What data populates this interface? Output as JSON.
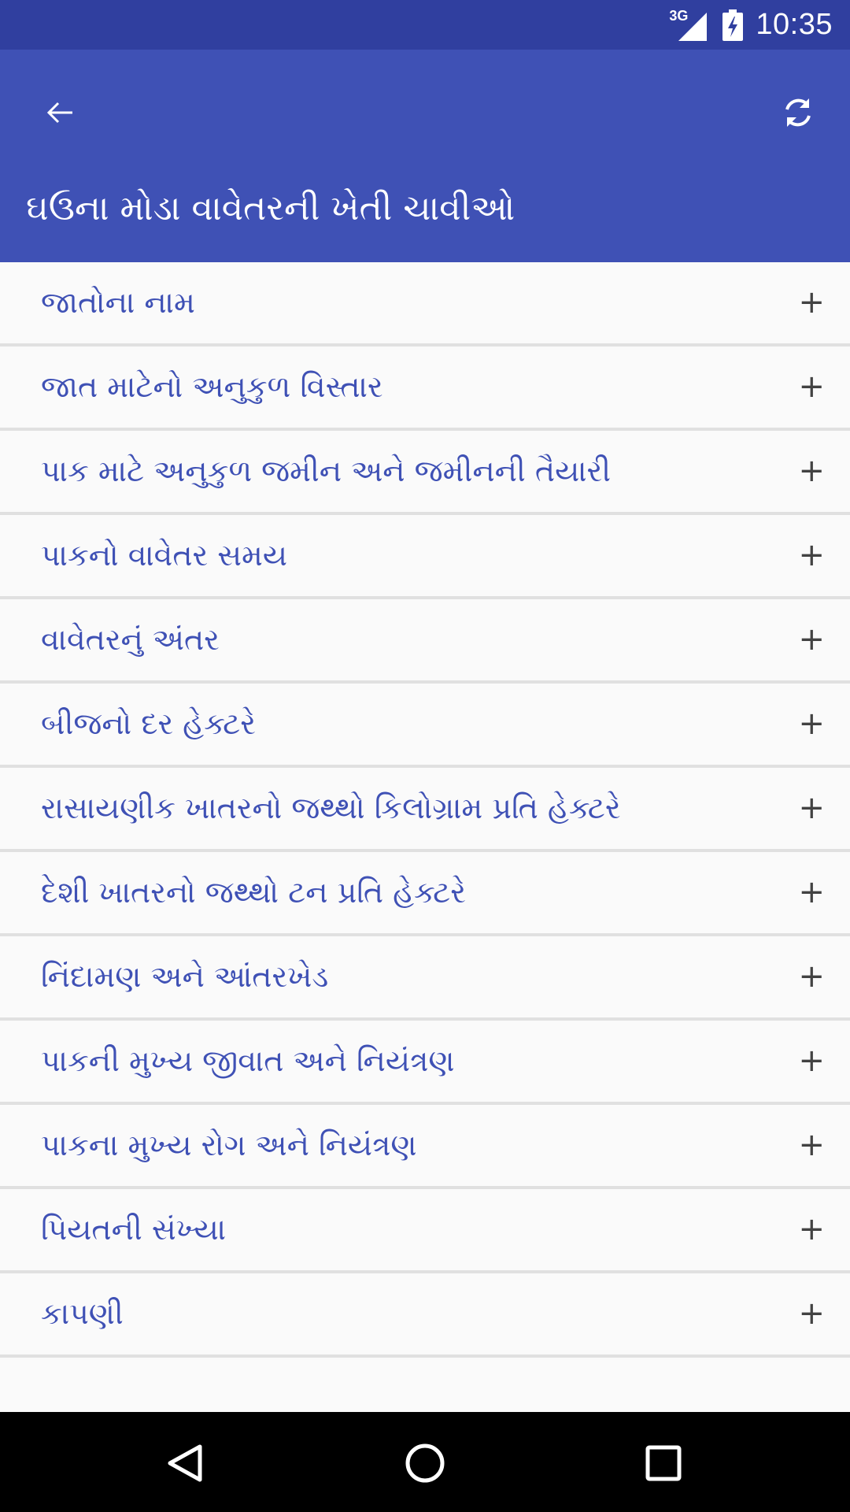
{
  "status_bar": {
    "network": "3G",
    "time": "10:35"
  },
  "app_bar": {
    "title": "ઘઉના મોડા વાવેતરની ખેતી ચાવીઓ",
    "back_icon": "arrow-left-icon",
    "refresh_icon": "refresh-icon"
  },
  "list": {
    "items": [
      {
        "label": "જાતોના નામ"
      },
      {
        "label": "જાત માટેનો અનુકુળ વિસ્તાર"
      },
      {
        "label": "પાક માટે અનુકુળ જમીન અને જમીનની તૈયારી"
      },
      {
        "label": "પાકનો વાવેતર સમય"
      },
      {
        "label": "વાવેતરનું અંતર"
      },
      {
        "label": "બીજનો દર હેક્ટરે"
      },
      {
        "label": "રાસાયણીક ખાતરનો જથ્થો કિલોગ્રામ પ્રતિ હેક્ટરે"
      },
      {
        "label": "દેશી ખાતરનો જથ્થો ટન પ્રતિ હેક્ટરે"
      },
      {
        "label": "નિંદામણ અને આંતરખેડ"
      },
      {
        "label": "પાકની મુખ્ય જીવાત અને નિયંત્રણ"
      },
      {
        "label": "પાકના મુખ્ય રોગ અને નિયંત્રણ"
      },
      {
        "label": "પિયતની સંખ્યા"
      },
      {
        "label": "કાપણી"
      },
      {
        "label": ""
      }
    ],
    "expand_symbol": "+"
  },
  "nav_bar": {
    "back_icon": "nav-back-icon",
    "home_icon": "nav-home-icon",
    "recents_icon": "nav-recents-icon"
  },
  "colors": {
    "status_bar": "#303f9f",
    "app_bar": "#3f51b5",
    "item_text": "#3f51b5",
    "divider": "#e0e0e0",
    "background": "#fafafa"
  }
}
